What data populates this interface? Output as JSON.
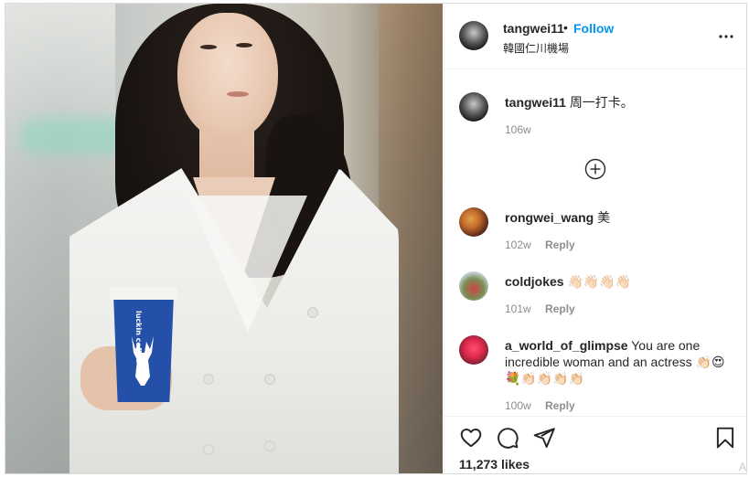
{
  "post": {
    "author": "tangwei11",
    "separator": "•",
    "follow_label": "Follow",
    "location": "韓國仁川機場",
    "caption": {
      "user": "tangwei11",
      "text": "周一打卡。",
      "age": "106w"
    },
    "photo": {
      "cup_brand": "luckin coffee"
    }
  },
  "comments": [
    {
      "user": "rongwei_wang",
      "text": "美",
      "age": "102w",
      "reply_label": "Reply"
    },
    {
      "user": "coldjokes",
      "text": "👋🏻👋🏻👋🏻👋🏻",
      "age": "101w",
      "reply_label": "Reply"
    },
    {
      "user": "a_world_of_glimpse",
      "text": "You are one incredible woman and an actress 👏🏻😍💐👏🏻👏🏻👏🏻👏🏻",
      "age": "100w",
      "reply_label": "Reply"
    }
  ],
  "engagement": {
    "likes": "11,273 likes",
    "scroll_hint": "A"
  },
  "icons": {
    "more": "more-options-icon",
    "load_more": "add-circle-icon",
    "like": "heart-icon",
    "comment": "comment-icon",
    "share": "share-icon",
    "save": "bookmark-icon"
  },
  "colors": {
    "follow": "#0095f6",
    "text": "#262626",
    "secondary": "#8e8e8e",
    "divider": "#efefef"
  }
}
